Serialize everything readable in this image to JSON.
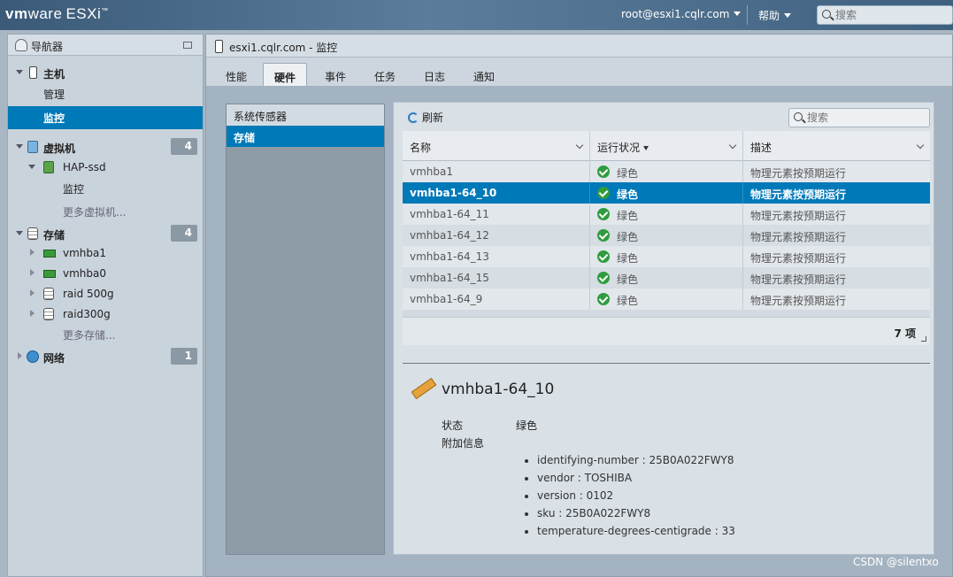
{
  "topbar": {
    "brand_vm": "vm",
    "brand_ware": "ware",
    "brand_product": "ESXi",
    "brand_tm": "™",
    "user": "root@esxi1.cqlr.com",
    "help": "帮助",
    "search_placeholder": "搜索"
  },
  "navigator": {
    "title": "导航器",
    "host": {
      "label": "主机",
      "children": [
        "管理",
        "监控"
      ]
    },
    "vms": {
      "label": "虚拟机",
      "count": "4",
      "vm_name": "HAP-ssd",
      "vm_child": "监控",
      "more": "更多虚拟机..."
    },
    "storage": {
      "label": "存储",
      "count": "4",
      "items": [
        "vmhba1",
        "vmhba0",
        "raid 500g",
        "raid300g"
      ],
      "more": "更多存储..."
    },
    "network": {
      "label": "网络",
      "count": "1"
    }
  },
  "main": {
    "title": "esxi1.cqlr.com - 监控",
    "tabs": [
      "性能",
      "硬件",
      "事件",
      "任务",
      "日志",
      "通知"
    ],
    "active_tab": "硬件",
    "subnav": [
      "系统传感器",
      "存储"
    ],
    "toolbar": {
      "refresh": "刷新",
      "search_placeholder": "搜索"
    },
    "grid": {
      "columns": [
        "名称",
        "运行状况",
        "描述"
      ],
      "rows": [
        {
          "name": "vmhba1",
          "status": "绿色",
          "desc": "物理元素按预期运行"
        },
        {
          "name": "vmhba1-64_10",
          "status": "绿色",
          "desc": "物理元素按预期运行"
        },
        {
          "name": "vmhba1-64_11",
          "status": "绿色",
          "desc": "物理元素按预期运行"
        },
        {
          "name": "vmhba1-64_12",
          "status": "绿色",
          "desc": "物理元素按预期运行"
        },
        {
          "name": "vmhba1-64_13",
          "status": "绿色",
          "desc": "物理元素按预期运行"
        },
        {
          "name": "vmhba1-64_15",
          "status": "绿色",
          "desc": "物理元素按预期运行"
        },
        {
          "name": "vmhba1-64_9",
          "status": "绿色",
          "desc": "物理元素按预期运行"
        }
      ],
      "selected_row": 1,
      "count": "7 项"
    },
    "detail": {
      "title": "vmhba1-64_10",
      "status_label": "状态",
      "status_value": "绿色",
      "extra_label": "附加信息",
      "extra": [
        "identifying-number : 25B0A022FWY8",
        "vendor : TOSHIBA",
        "version : 0102",
        "sku : 25B0A022FWY8",
        "temperature-degrees-centigrade : 33"
      ]
    }
  },
  "watermark": "CSDN @silentxo",
  "colors": {
    "selection": "#0079b8",
    "status_ok": "#2f9c3e",
    "topbar": "#3a5a78"
  }
}
